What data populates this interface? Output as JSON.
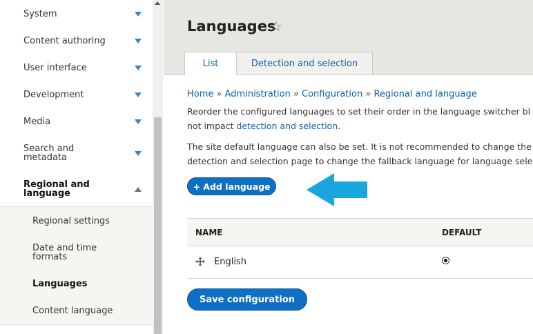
{
  "sidebar": {
    "items": [
      {
        "label": "System"
      },
      {
        "label": "Content authoring"
      },
      {
        "label": "User interface"
      },
      {
        "label": "Development"
      },
      {
        "label": "Media"
      },
      {
        "label": "Search and metadata"
      },
      {
        "label": "Regional and language"
      }
    ],
    "subitems": [
      {
        "label": "Regional settings"
      },
      {
        "label": "Date and time formats"
      },
      {
        "label": "Languages"
      },
      {
        "label": "Content language"
      }
    ]
  },
  "header": {
    "title": "Languages",
    "tabs": [
      {
        "label": "List"
      },
      {
        "label": "Detection and selection"
      }
    ]
  },
  "breadcrumb": [
    {
      "label": "Home"
    },
    {
      "label": "Administration"
    },
    {
      "label": "Configuration"
    },
    {
      "label": "Regional and language"
    }
  ],
  "breadcrumb_sep": "»",
  "description": {
    "line1": "Reorder the configured languages to set their order in the language switcher bl",
    "line2_prefix": "not impact ",
    "line2_link": "detection and selection",
    "line2_suffix": ".",
    "line3": "The site default language can also be set. It is not recommended to change the",
    "line4": "detection and selection page to change the fallback language for language selec"
  },
  "add_language_button": "+ Add language",
  "table": {
    "headers": [
      "NAME",
      "DEFAULT"
    ],
    "rows": [
      {
        "name": "English",
        "default": true
      }
    ]
  },
  "save_button": "Save configuration",
  "colors": {
    "accent": "#0f6fc4",
    "link": "#0f5ea8",
    "callout_arrow": "#1aa6df"
  },
  "icons": {
    "star": "star-icon",
    "drag": "drag-handle-icon",
    "callout": "arrow-left-icon"
  }
}
